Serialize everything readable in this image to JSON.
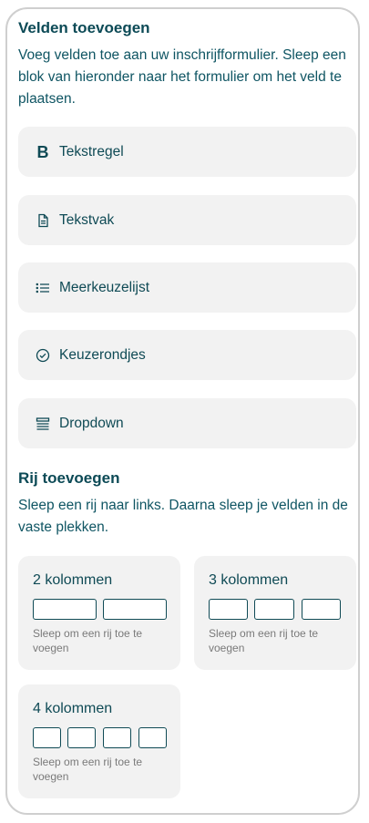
{
  "fields_section": {
    "title": "Velden toevoegen",
    "description": "Voeg velden toe aan uw inschrijfformulier. Sleep een blok van hieronder naar het formulier om het veld te plaatsen."
  },
  "fields": [
    {
      "label": "Tekstregel",
      "icon": "bold-b-icon"
    },
    {
      "label": "Tekstvak",
      "icon": "document-icon"
    },
    {
      "label": "Meerkeuzelijst",
      "icon": "list-icon"
    },
    {
      "label": "Keuzerondjes",
      "icon": "check-circle-icon"
    },
    {
      "label": "Dropdown",
      "icon": "stack-icon"
    }
  ],
  "rows_section": {
    "title": "Rij toevoegen",
    "description": "Sleep een rij naar links. Daarna sleep je velden in de vaste plekken."
  },
  "rows": [
    {
      "title": "2 kolommen",
      "columns": 2,
      "hint": "Sleep om een rij toe te voegen"
    },
    {
      "title": "3 kolommen",
      "columns": 3,
      "hint": "Sleep om een rij toe te voegen"
    },
    {
      "title": "4 kolommen",
      "columns": 4,
      "hint": "Sleep om een rij toe te voegen"
    }
  ],
  "colors": {
    "accent": "#0f4a55",
    "block_background": "#f2f2f2",
    "panel_border": "#cfcfcf"
  }
}
